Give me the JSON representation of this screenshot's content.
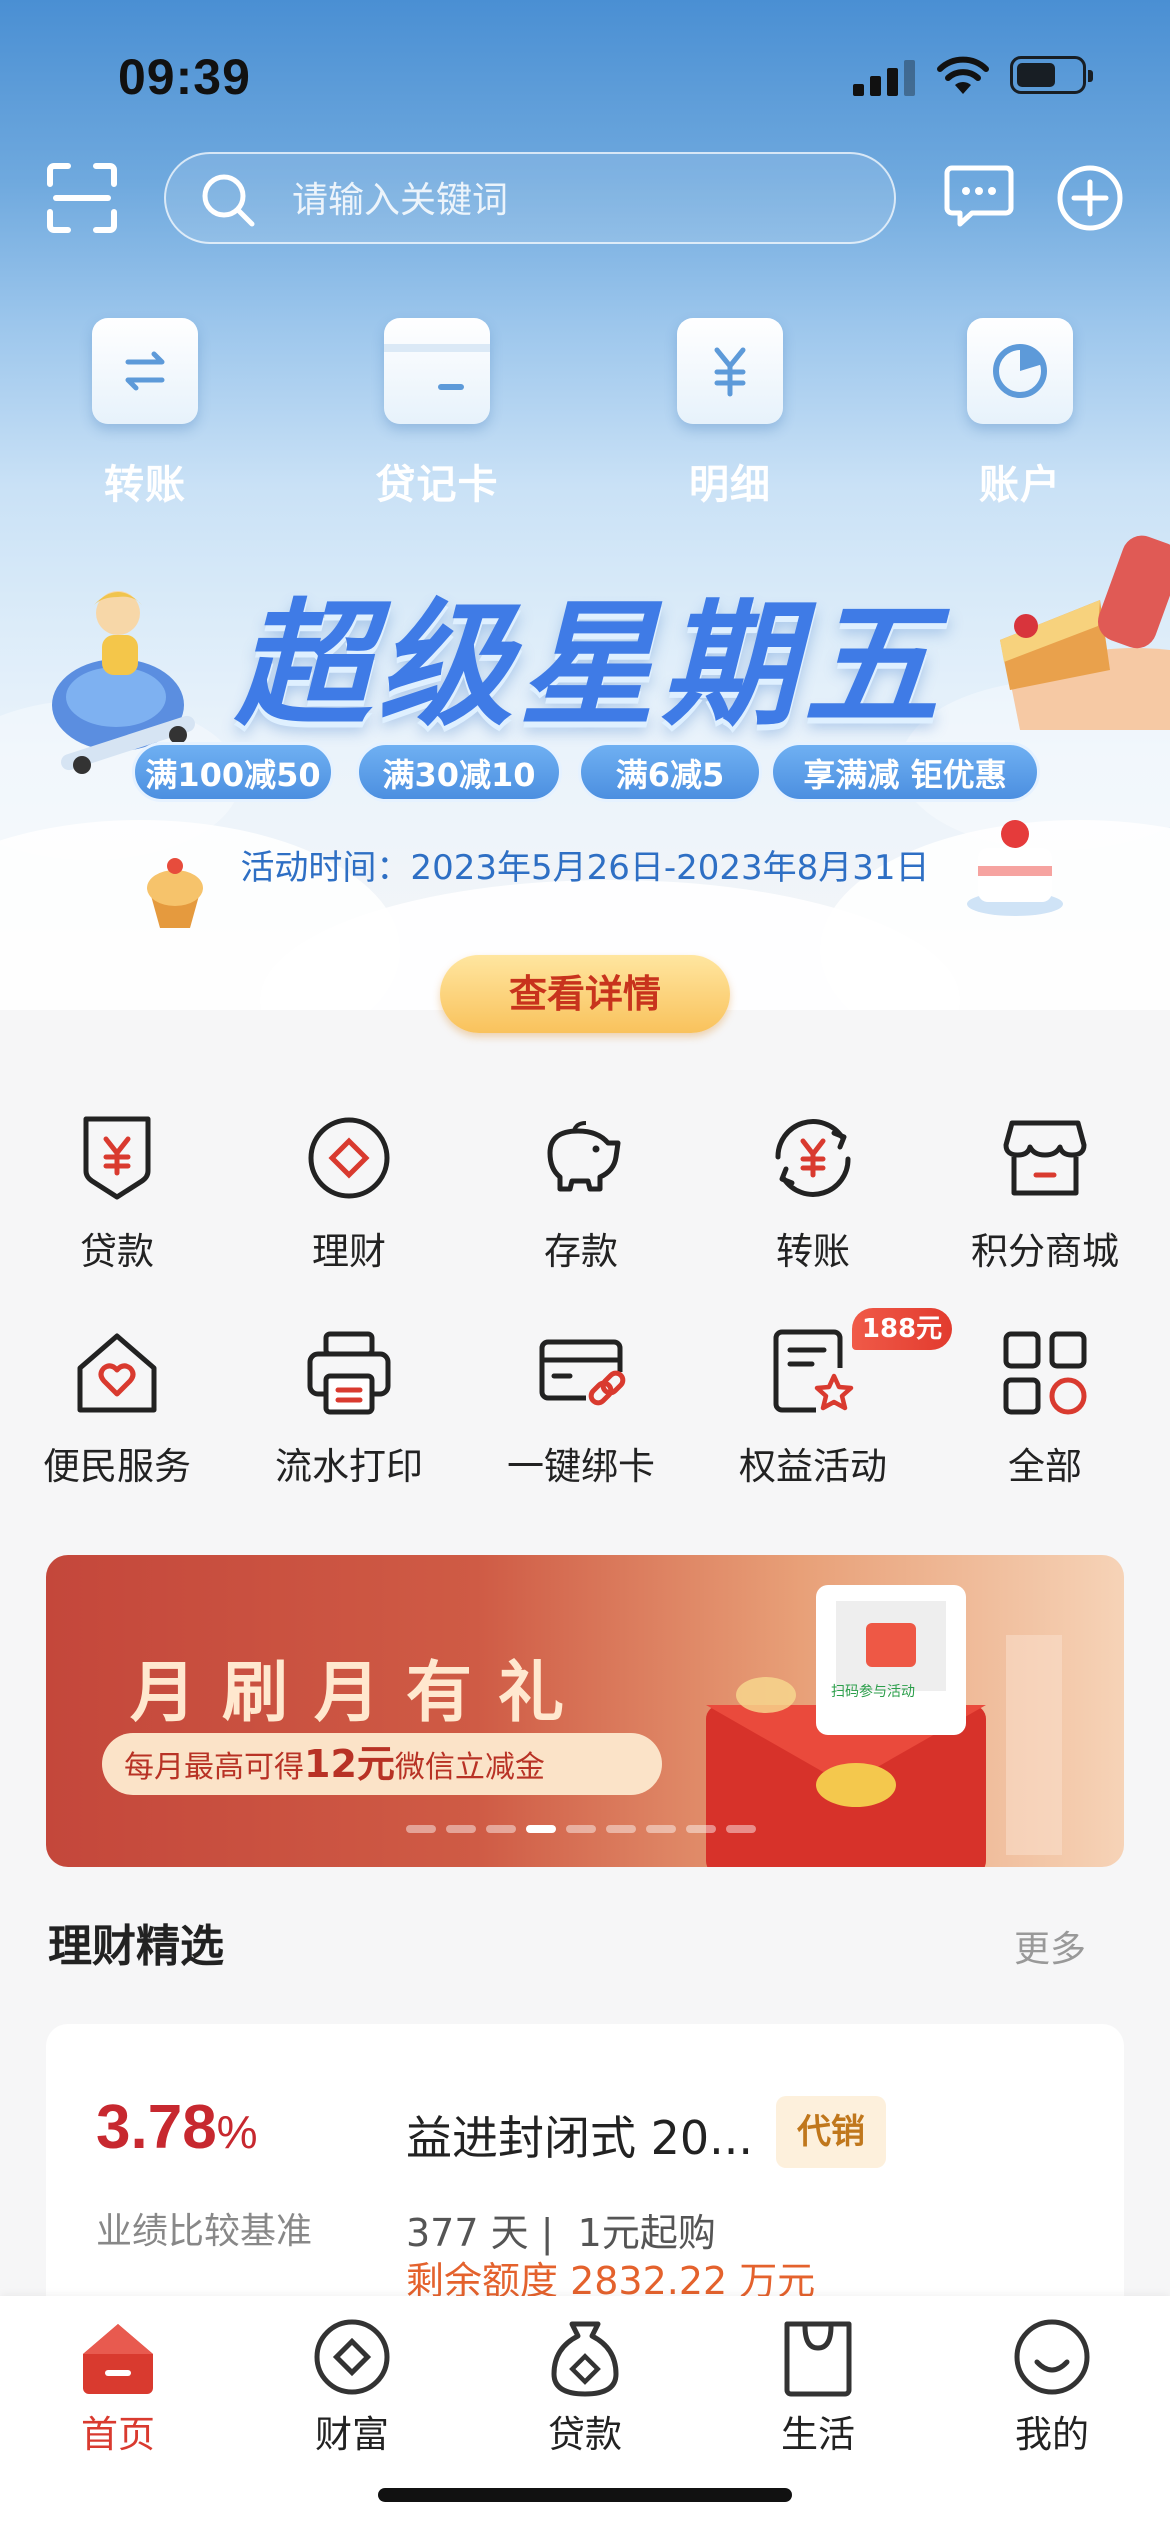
{
  "status": {
    "time": "09:39"
  },
  "search": {
    "placeholder": "请输入关键词"
  },
  "quick_actions": [
    {
      "label": "转账",
      "icon": "transfer-arrows-icon"
    },
    {
      "label": "贷记卡",
      "icon": "credit-card-icon"
    },
    {
      "label": "明细",
      "icon": "yuan-details-icon"
    },
    {
      "label": "账户",
      "icon": "pie-chart-icon"
    }
  ],
  "promo": {
    "title": "超级星期五",
    "chips": [
      "满100减50",
      "满30减10",
      "满6减5",
      "享满减 钜优惠"
    ],
    "period": "活动时间：2023年5月26日-2023年8月31日",
    "button": "查看详情"
  },
  "menu": [
    {
      "label": "贷款",
      "icon": "loan-yuan-icon"
    },
    {
      "label": "理财",
      "icon": "wealth-diamond-icon"
    },
    {
      "label": "存款",
      "icon": "piggy-bank-icon"
    },
    {
      "label": "转账",
      "icon": "transfer-cycle-icon"
    },
    {
      "label": "积分商城",
      "icon": "store-icon"
    },
    {
      "label": "便民服务",
      "icon": "home-heart-icon"
    },
    {
      "label": "流水打印",
      "icon": "printer-icon"
    },
    {
      "label": "一键绑卡",
      "icon": "card-link-icon"
    },
    {
      "label": "权益活动",
      "icon": "star-document-icon"
    },
    {
      "label": "全部",
      "icon": "all-grid-icon"
    }
  ],
  "menu_badge": "188元",
  "ad": {
    "title": "月刷月有礼",
    "sub_prefix": "每月最高可得",
    "sub_amount": "12元",
    "sub_suffix": "微信立减金",
    "qr_caption": "扫码参与活动",
    "slide_count": 9,
    "active_slide": 4
  },
  "section": {
    "title": "理财精选",
    "more": "更多"
  },
  "product": {
    "rate": "3.78",
    "rate_unit": "%",
    "rate_label": "业绩比较基准",
    "name": "益进封闭式 20...",
    "tag": "代销",
    "term": "377 天 |",
    "min_buy": "1元起购",
    "quota": "剩余额度 2832.22 万元"
  },
  "tabs": [
    {
      "label": "首页",
      "icon": "home-icon",
      "active": true
    },
    {
      "label": "财富",
      "icon": "wealth-icon",
      "active": false
    },
    {
      "label": "贷款",
      "icon": "loan-bag-icon",
      "active": false
    },
    {
      "label": "生活",
      "icon": "shopping-bag-icon",
      "active": false
    },
    {
      "label": "我的",
      "icon": "smiley-icon",
      "active": false
    }
  ],
  "colors": {
    "brand_red": "#d93a2f",
    "promo_blue": "#3f7be6",
    "quota_orange": "#e4622d",
    "rate_red": "#c7282f"
  }
}
